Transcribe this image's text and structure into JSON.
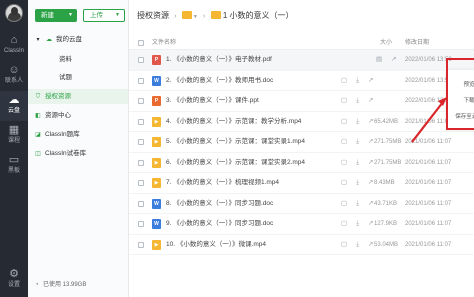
{
  "nav": {
    "items": [
      {
        "label": "ClassIn",
        "icon": "home-icon"
      },
      {
        "label": "联系人",
        "icon": "contacts-icon"
      },
      {
        "label": "云盘",
        "icon": "cloud-icon"
      },
      {
        "label": "课程",
        "icon": "course-icon"
      },
      {
        "label": "黑板",
        "icon": "blackboard-icon"
      },
      {
        "label": "设置",
        "icon": "settings-icon"
      }
    ]
  },
  "sidebar": {
    "new_label": "新建",
    "upload_label": "上传",
    "my_cloud": "我的云盘",
    "sub_materials": "资料",
    "sub_quizzes": "试题",
    "authorized": "授权资源",
    "resource_center": "资源中心",
    "classin_library": "ClassIn题库",
    "classin_test_library": "ClassIn试卷库",
    "storage": "已使用 13.99GB"
  },
  "breadcrumb": {
    "root": "授权资源",
    "current": "1 小数的意义（一）"
  },
  "table": {
    "headers": {
      "name": "文件名称",
      "size": "大小",
      "date": "修改日期"
    },
    "rows": [
      {
        "type": "pdf",
        "badge": "P",
        "color": "#e2574c",
        "name": "1. 《小数的意义（一）》电子教材.pdf",
        "size": "",
        "date": "2022/01/06 13:59"
      },
      {
        "type": "doc",
        "badge": "W",
        "color": "#3b7ddd",
        "name": "2. 《小数的意义（一）》教师用书.doc",
        "size": "",
        "date": "2022/01/06 13:59"
      },
      {
        "type": "ppt",
        "badge": "P",
        "color": "#ea6b2f",
        "name": "3. 《小数的意义（一）》课件.ppt",
        "size": "",
        "date": "2022/01/06 13:59"
      },
      {
        "type": "mp4",
        "badge": "▶",
        "color": "#f5b631",
        "name": "4. 《小数的意义（一）》示范课：教学分析.mp4",
        "size": "65.42MB",
        "date": "2021/01/06 11:07"
      },
      {
        "type": "mp4",
        "badge": "▶",
        "color": "#f5b631",
        "name": "5. 《小数的意义（一）》示范课：课堂实录1.mp4",
        "size": "271.75MB",
        "date": "2021/01/06 11:07"
      },
      {
        "type": "mp4",
        "badge": "▶",
        "color": "#f5b631",
        "name": "6. 《小数的意义（一）》示范课：课堂实录2.mp4",
        "size": "271.75MB",
        "date": "2021/01/06 11:07"
      },
      {
        "type": "mp4",
        "badge": "▶",
        "color": "#f5b631",
        "name": "7. 《小数的意义（一）》梳理视频1.mp4",
        "size": "8.43MB",
        "date": "2021/01/06 11:07"
      },
      {
        "type": "doc",
        "badge": "W",
        "color": "#3b7ddd",
        "name": "8. 《小数的意义（一）》同步习题.doc",
        "size": "43.71KB",
        "date": "2021/01/06 11:07"
      },
      {
        "type": "doc",
        "badge": "W",
        "color": "#3b7ddd",
        "name": "9. 《小数的意义（一）》同步习题.doc",
        "size": "127.9KB",
        "date": "2021/01/06 11:07"
      },
      {
        "type": "mp4",
        "badge": "▶",
        "color": "#f5b631",
        "name": "10. 《小数的意义（一）》微课.mp4",
        "size": "53.04MB",
        "date": "2021/01/06 11:07"
      }
    ]
  },
  "row_actions": {
    "preview_icon": "preview-icon",
    "more_icon": "share-icon",
    "download_icon": "download-icon"
  },
  "context_menu": {
    "preview": "预览",
    "download": "下载",
    "save_to_cloud": "保存至云盘"
  },
  "colors": {
    "accent": "#2ba245",
    "highlight": "#d9262b",
    "nav_bg": "#262b33"
  }
}
